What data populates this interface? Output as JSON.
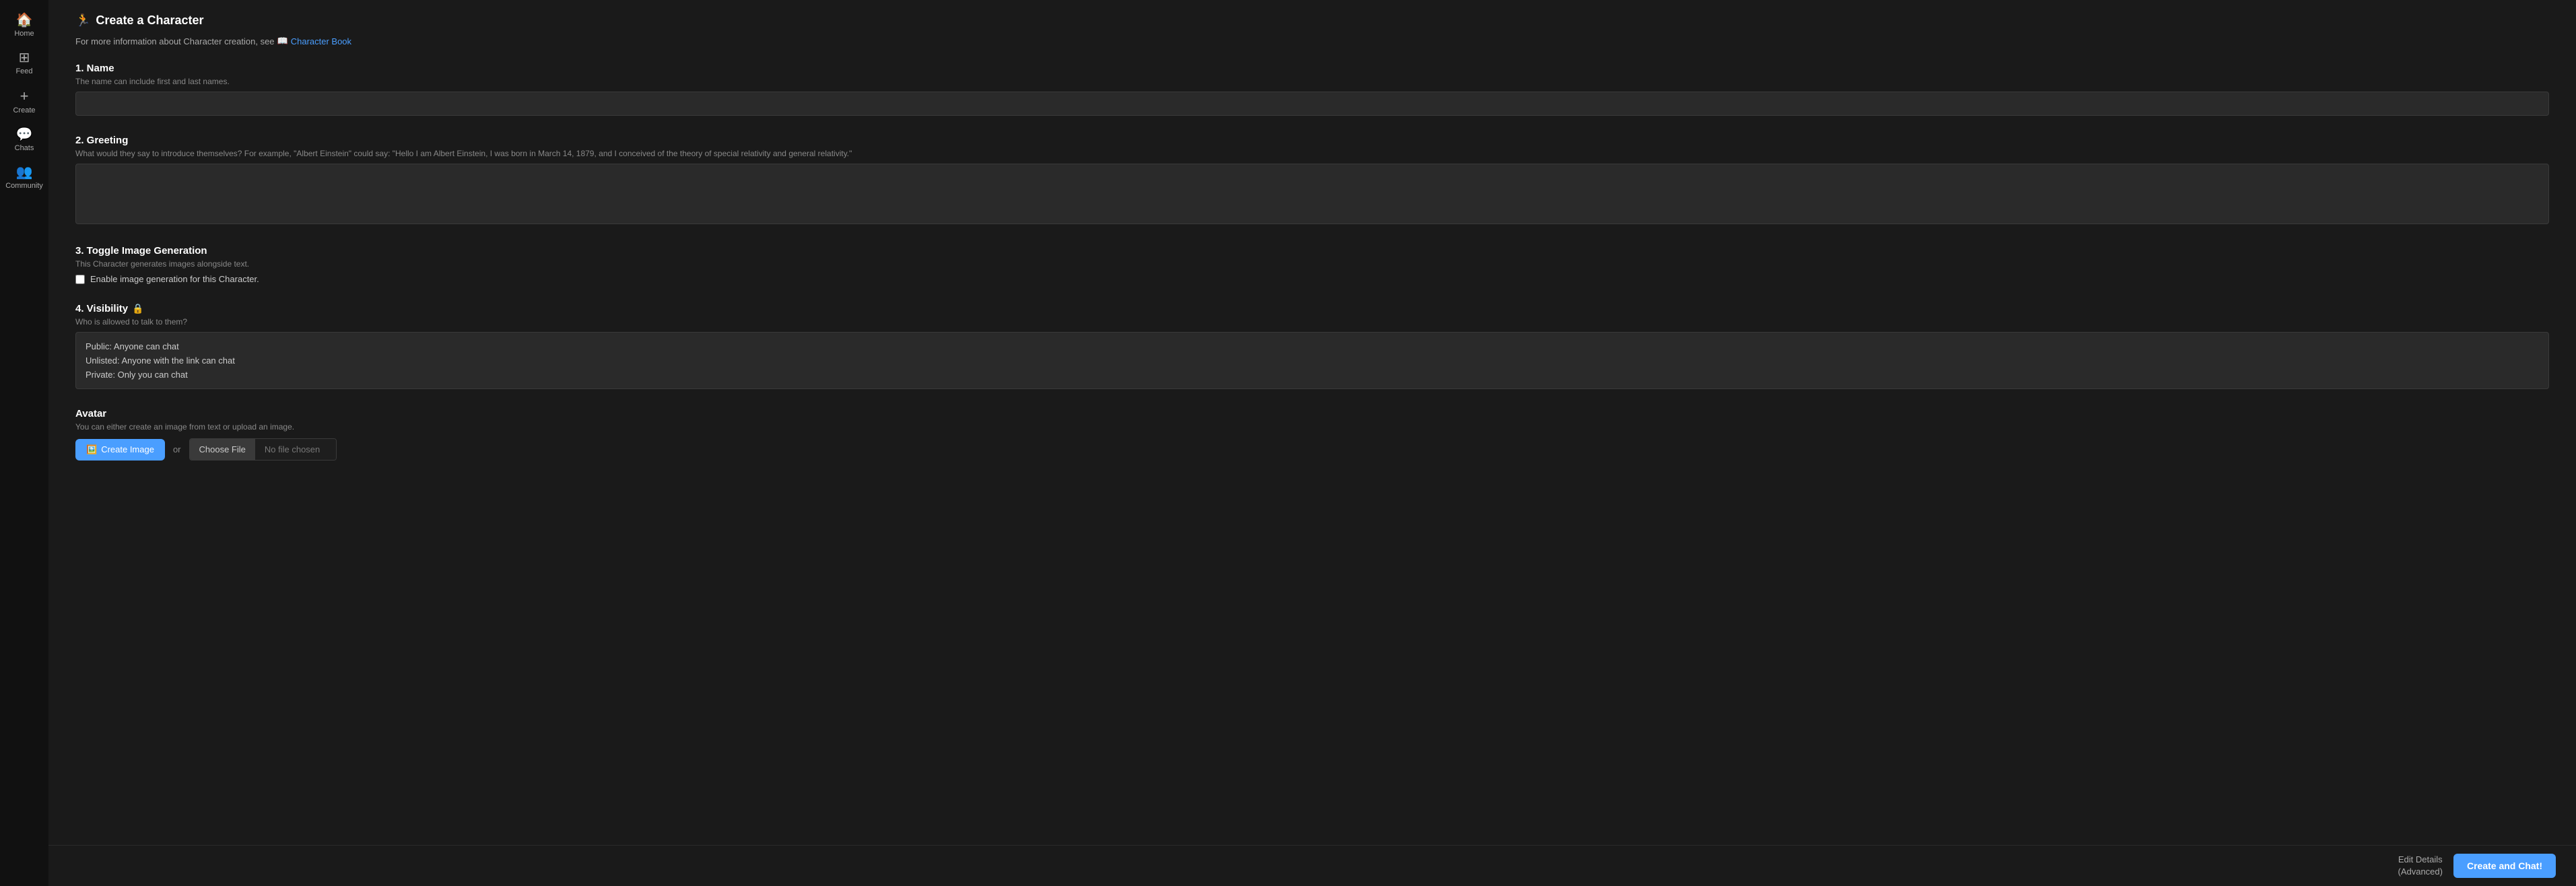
{
  "sidebar": {
    "items": [
      {
        "id": "home",
        "label": "Home",
        "icon": "🏠"
      },
      {
        "id": "feed",
        "label": "Feed",
        "icon": "⊞"
      },
      {
        "id": "create",
        "label": "Create",
        "icon": "+"
      },
      {
        "id": "chats",
        "label": "Chats",
        "icon": "💬"
      },
      {
        "id": "community",
        "label": "Community",
        "icon": "👥"
      }
    ]
  },
  "header": {
    "title_icon": "🏃",
    "title": "Create a Character",
    "info_prefix": "For more information about Character creation, see",
    "book_icon": "📖",
    "book_link": "Character Book"
  },
  "sections": {
    "name": {
      "title": "1. Name",
      "subtitle": "The name can include first and last names.",
      "placeholder": ""
    },
    "greeting": {
      "title": "2. Greeting",
      "subtitle": "What would they say to introduce themselves? For example, \"Albert Einstein\" could say: \"Hello I am Albert Einstein, I was born in March 14, 1879, and I conceived of the theory of special relativity and general relativity.\"",
      "placeholder": ""
    },
    "toggle_image": {
      "title": "3. Toggle Image Generation",
      "subtitle": "This Character generates images alongside text.",
      "checkbox_label": "Enable image generation for this Character."
    },
    "visibility": {
      "title": "4. Visibility",
      "lock_icon": "🔒",
      "subtitle": "Who is allowed to talk to them?",
      "options": [
        "Public: Anyone can chat",
        "Unlisted: Anyone with the link can chat",
        "Private: Only you can chat"
      ]
    },
    "avatar": {
      "title": "Avatar",
      "subtitle": "You can either create an image from text or upload an image.",
      "create_image_icon": "🖼️",
      "create_image_label": "Create Image",
      "or_label": "or",
      "choose_file_label": "Choose File",
      "no_file_text": "No file chosen"
    }
  },
  "footer": {
    "edit_details_line1": "Edit Details",
    "edit_details_line2": "(Advanced)",
    "create_chat_label": "Create and Chat!"
  }
}
